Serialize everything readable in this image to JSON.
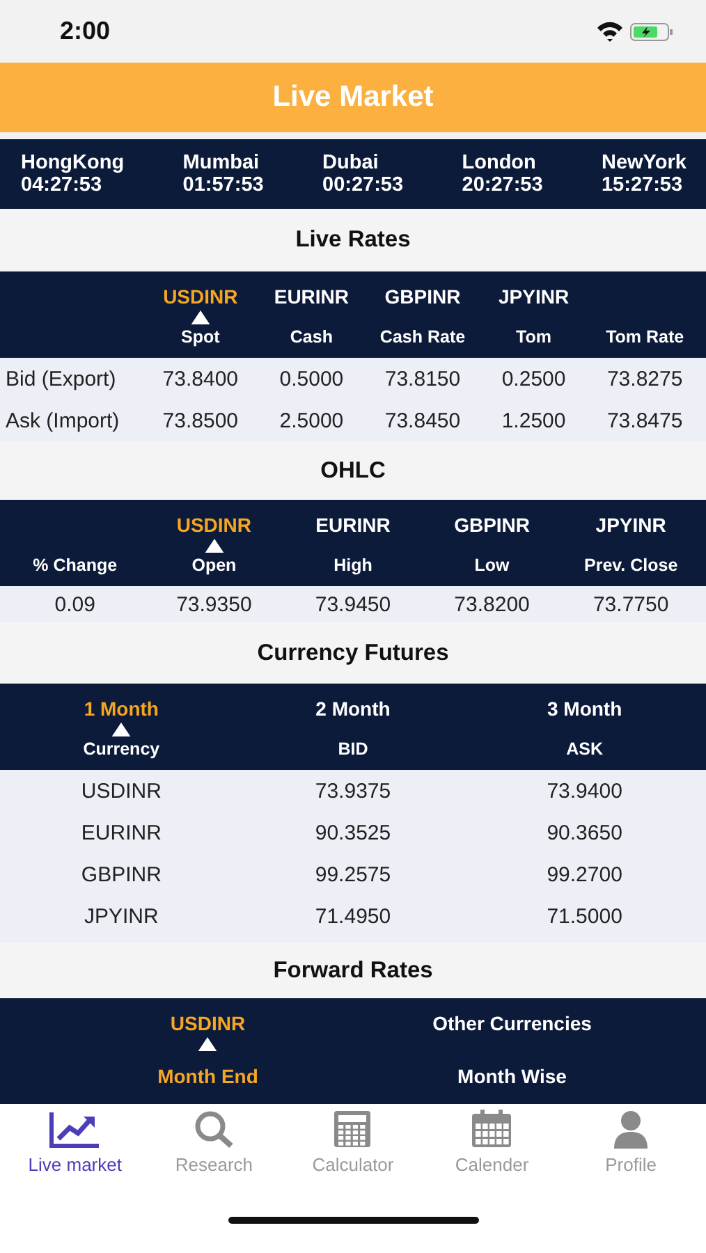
{
  "status_bar": {
    "time": "2:00"
  },
  "header": {
    "title": "Live Market"
  },
  "cities": [
    {
      "name": "HongKong",
      "time": "04:27:53"
    },
    {
      "name": "Mumbai",
      "time": "01:57:53"
    },
    {
      "name": "Dubai",
      "time": "00:27:53"
    },
    {
      "name": "London",
      "time": "20:27:53"
    },
    {
      "name": "NewYork",
      "time": "15:27:53"
    }
  ],
  "live_rates": {
    "title": "Live Rates",
    "tabs": [
      {
        "label": "USDINR",
        "selected": true
      },
      {
        "label": "EURINR",
        "selected": false
      },
      {
        "label": "GBPINR",
        "selected": false
      },
      {
        "label": "JPYINR",
        "selected": false
      }
    ],
    "columns": [
      "Spot",
      "Cash",
      "Cash Rate",
      "Tom",
      "Tom Rate"
    ],
    "rows": [
      {
        "label": "Bid (Export)",
        "values": [
          "73.8400",
          "0.5000",
          "73.8150",
          "0.2500",
          "73.8275"
        ]
      },
      {
        "label": "Ask (Import)",
        "values": [
          "73.8500",
          "2.5000",
          "73.8450",
          "1.2500",
          "73.8475"
        ]
      }
    ]
  },
  "ohlc": {
    "title": "OHLC",
    "tabs": [
      {
        "label": "USDINR",
        "selected": true
      },
      {
        "label": "EURINR",
        "selected": false
      },
      {
        "label": "GBPINR",
        "selected": false
      },
      {
        "label": "JPYINR",
        "selected": false
      }
    ],
    "columns": [
      "% Change",
      "Open",
      "High",
      "Low",
      "Prev. Close"
    ],
    "rows": [
      {
        "values": [
          "0.09",
          "73.9350",
          "73.9450",
          "73.8200",
          "73.7750"
        ]
      }
    ]
  },
  "currency_futures": {
    "title": "Currency Futures",
    "tabs": [
      {
        "label": "1 Month",
        "selected": true
      },
      {
        "label": "2 Month",
        "selected": false
      },
      {
        "label": "3 Month",
        "selected": false
      }
    ],
    "columns": [
      "Currency",
      "BID",
      "ASK"
    ],
    "rows": [
      {
        "values": [
          "USDINR",
          "73.9375",
          "73.9400"
        ]
      },
      {
        "values": [
          "EURINR",
          "90.3525",
          "90.3650"
        ]
      },
      {
        "values": [
          "GBPINR",
          "99.2575",
          "99.2700"
        ]
      },
      {
        "values": [
          "JPYINR",
          "71.4950",
          "71.5000"
        ]
      }
    ]
  },
  "forward_rates": {
    "title": "Forward Rates",
    "tabs": [
      {
        "label": "USDINR",
        "selected": true
      },
      {
        "label": "Other Currencies",
        "selected": false
      }
    ],
    "subtabs": [
      {
        "label": "Month End",
        "selected": true
      },
      {
        "label": "Month Wise",
        "selected": false
      }
    ]
  },
  "tab_bar": [
    {
      "label": "Live market",
      "kind": "chart",
      "selected": true
    },
    {
      "label": "Research",
      "kind": "search",
      "selected": false
    },
    {
      "label": "Calculator",
      "kind": "calculator",
      "selected": false
    },
    {
      "label": "Calender",
      "kind": "calendar",
      "selected": false
    },
    {
      "label": "Profile",
      "kind": "profile",
      "selected": false
    }
  ]
}
